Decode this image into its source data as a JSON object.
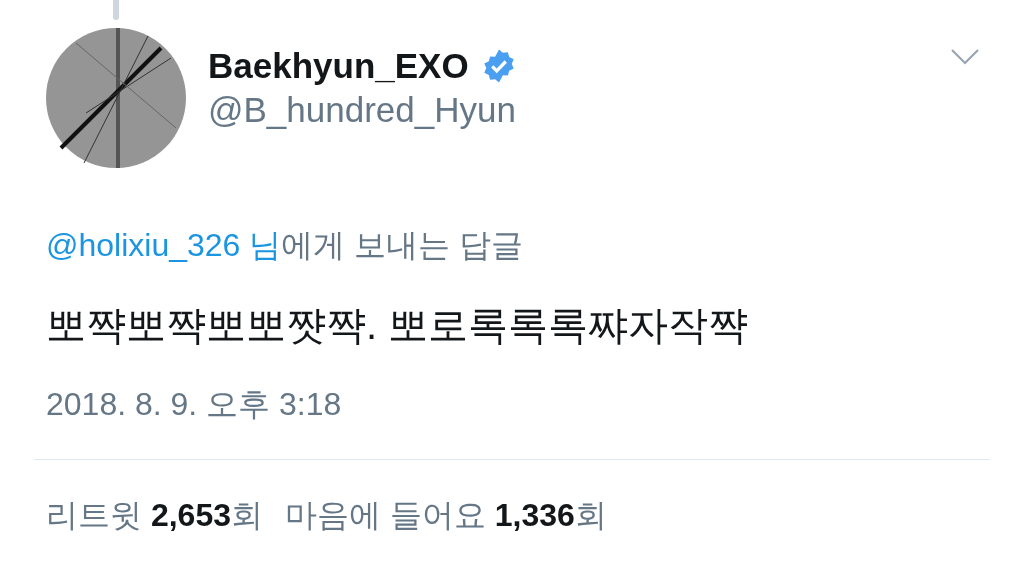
{
  "author": {
    "name": "Baekhyun_EXO",
    "verified": true,
    "handle": "@B_hundred_Hyun"
  },
  "reply": {
    "to": "@holixiu_326 님",
    "text": "에게 보내는 답글"
  },
  "tweet": {
    "text": "뽀쨕뽀쨕뽀뽀쨧쨕. 뽀로록록록쨔자작쨕",
    "timestamp": "2018. 8. 9. 오후 3:18"
  },
  "stats": [
    "리트윗 **2,653**회",
    "마음에 들어요 **1,336**회"
  ]
}
